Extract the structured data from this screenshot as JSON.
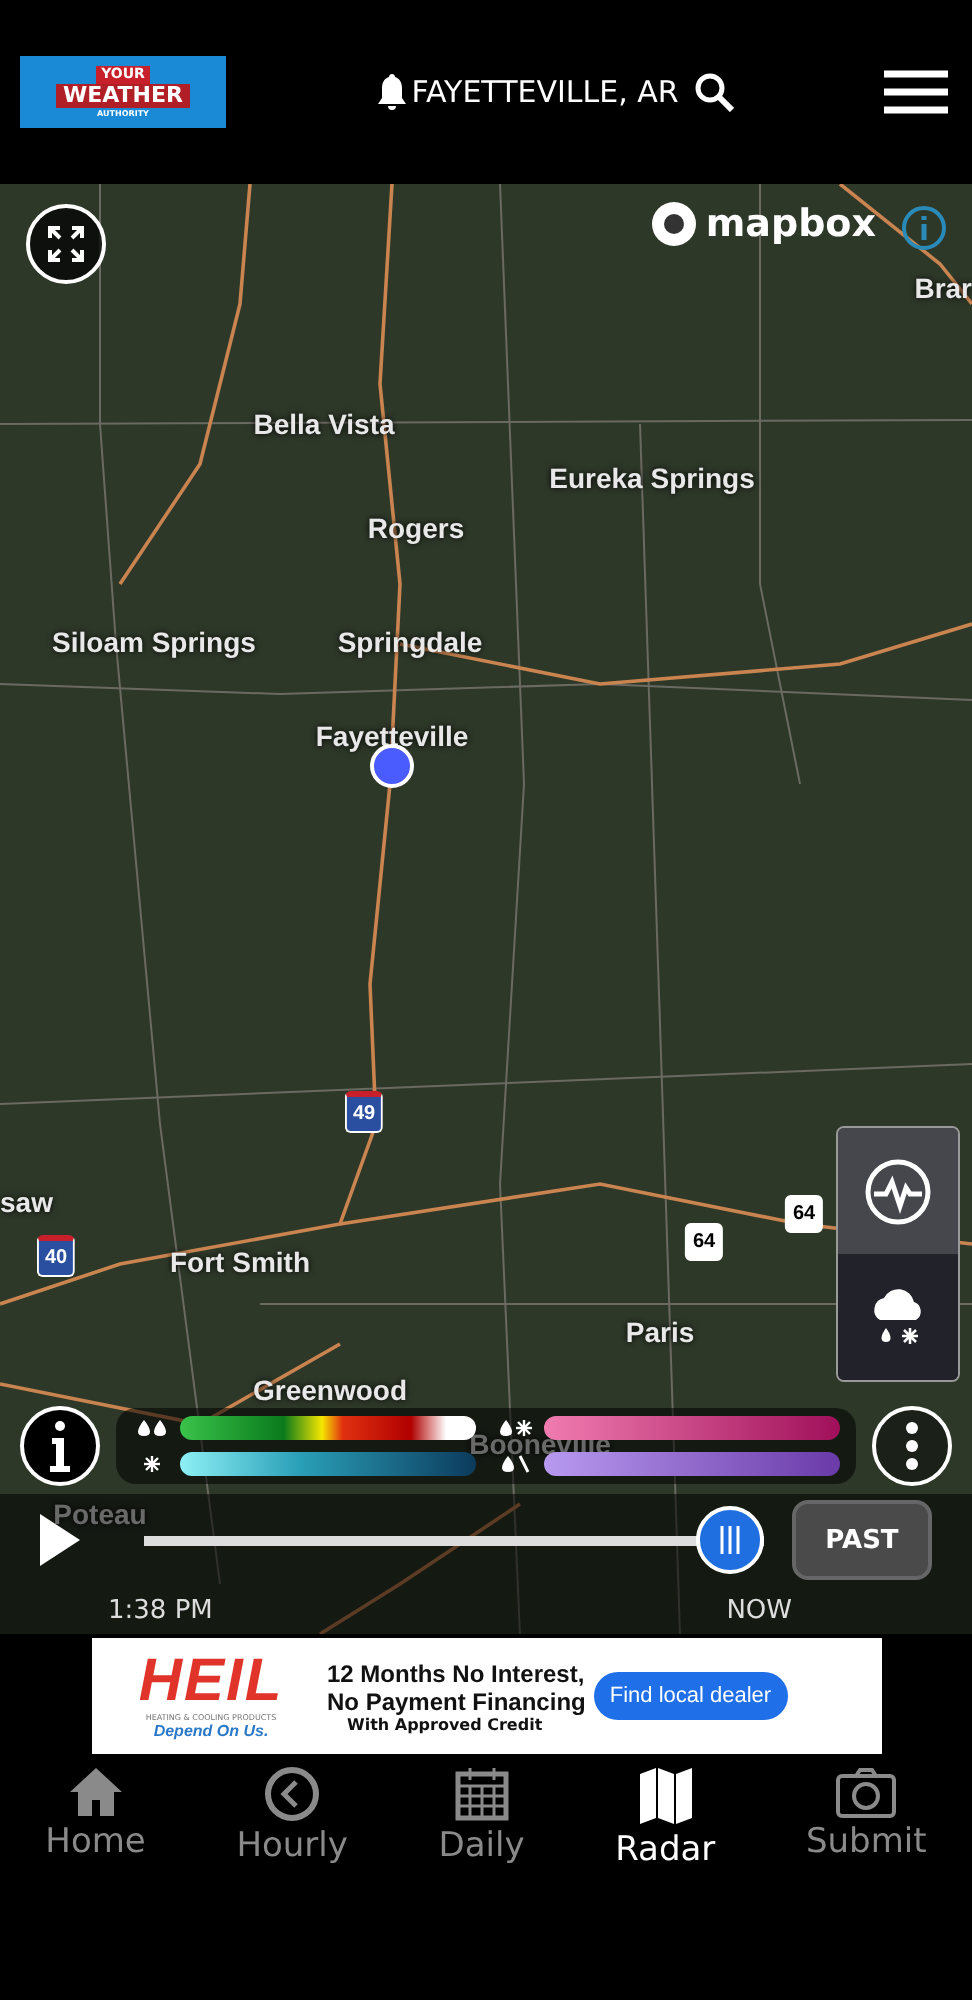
{
  "header": {
    "logo": {
      "top": "YOUR",
      "main": "WEATHER",
      "sub": "AUTHORITY"
    },
    "location": "FAYETTEVILLE, AR"
  },
  "map": {
    "attribution": "mapbox",
    "labels": [
      {
        "text": "Brar"
      },
      {
        "text": "Bella Vista"
      },
      {
        "text": "Eureka Springs"
      },
      {
        "text": "Rogers"
      },
      {
        "text": "Siloam Springs"
      },
      {
        "text": "Springdale"
      },
      {
        "text": "Fayetteville"
      },
      {
        "text": "saw"
      },
      {
        "text": "Fort Smith"
      },
      {
        "text": "Paris"
      },
      {
        "text": "Greenwood"
      },
      {
        "text": "Booneville"
      },
      {
        "text": "Poteau"
      }
    ],
    "shields": [
      {
        "text": "49",
        "kind": "interstate"
      },
      {
        "text": "40",
        "kind": "interstate"
      },
      {
        "text": "64",
        "kind": "us"
      },
      {
        "text": "64",
        "kind": "us"
      }
    ],
    "layers": [
      {
        "kind": "radar",
        "selected": false
      },
      {
        "kind": "precipitation",
        "selected": true
      }
    ]
  },
  "legend": [
    {
      "kind": "rain"
    },
    {
      "kind": "snow"
    },
    {
      "kind": "mix"
    },
    {
      "kind": "ice"
    }
  ],
  "timeline": {
    "level": 1,
    "start_time": "1:38 PM",
    "end_label": "NOW",
    "mode_button": "PAST",
    "playing": false
  },
  "ad": {
    "brand": "HEIL",
    "brand_sub": "HEATING & COOLING PRODUCTS",
    "tagline": "Depend On Us.",
    "headline_1": "12 Months No Interest,",
    "headline_2": "No Payment Financing",
    "note": "With Approved Credit",
    "cta": "Find local dealer"
  },
  "nav": [
    {
      "label": "Home",
      "selected": false
    },
    {
      "label": "Hourly",
      "selected": false
    },
    {
      "label": "Daily",
      "selected": false
    },
    {
      "label": "Radar",
      "selected": true
    },
    {
      "label": "Submit",
      "selected": false
    }
  ]
}
